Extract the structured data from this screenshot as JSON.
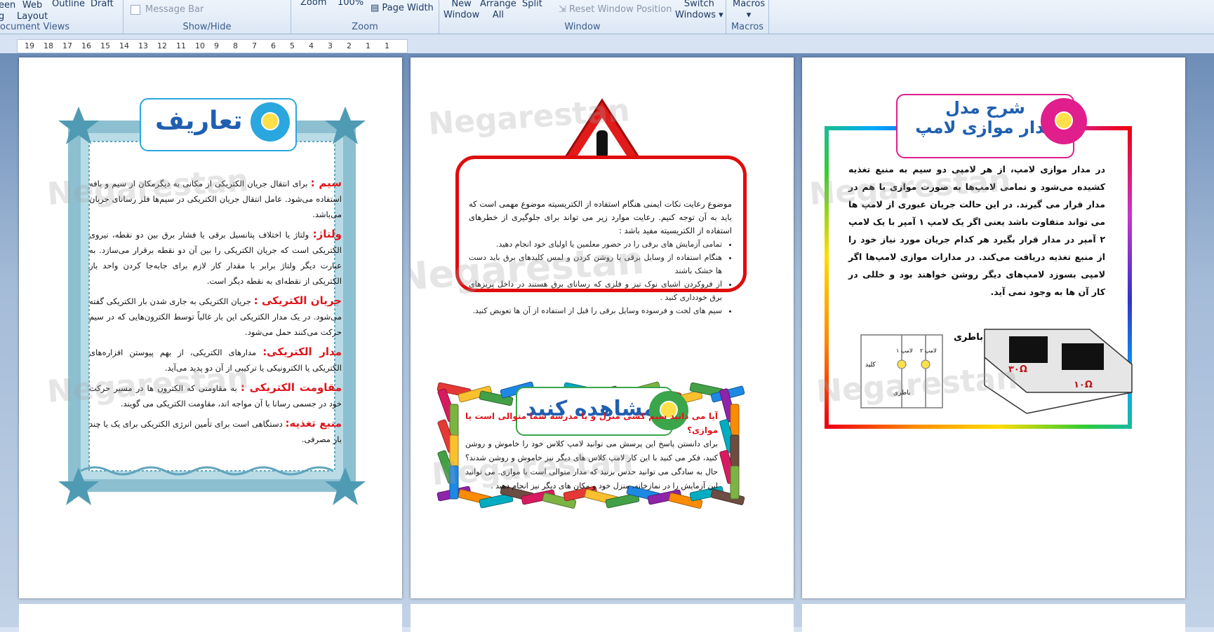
{
  "ribbon": {
    "document_views": {
      "full_screen": "een\ng",
      "web_layout": "Web\nLayout",
      "outline": "Outline",
      "draft": "Draft",
      "label": "ocument Views"
    },
    "show_hide": {
      "message_bar": "Message Bar",
      "label": "Show/Hide"
    },
    "zoom": {
      "zoom": "Zoom",
      "percent": "100%",
      "page_width": "Page Width",
      "label": "Zoom"
    },
    "window": {
      "new_window": "New\nWindow",
      "arrange_all": "Arrange\nAll",
      "split": "Split",
      "reset_position": "Reset Window Position",
      "switch_windows": "Switch\nWindows ▾",
      "label": "Window"
    },
    "macros": {
      "macros": "Macros\n▾",
      "label": "Macros"
    }
  },
  "ruler": {
    "ticks": [
      "19",
      "18",
      "17",
      "16",
      "15",
      "14",
      "13",
      "12",
      "11",
      "10",
      "9",
      "8",
      "7",
      "6",
      "5",
      "4",
      "3",
      "2",
      "1",
      "1"
    ]
  },
  "watermark": "Negarestan",
  "page1": {
    "title": "تعاریف",
    "definitions": [
      {
        "term": "سیم :",
        "text": " برای انتقال جریان الکتریکی از مکانی به دیگرمکان از سیم و بافه استفاده می‌شود. عامل انتقال جریان الکتریکی در سیم‌ها فلز رسانای جریان می‌باشد."
      },
      {
        "term": "ولتاژ:",
        "text": " ولتاژ یا اختلاف پتانسیل برقی یا فشار برق بین دو نقطه، نیروی الکتریکی است که جریان الکتریکی را بین آن دو نقطه برقرار می‌سازد. به عبارت دیگر ولتاژ برابر با مقدار کار لازم برای جابه‌جا کردن واحد بار الکتریکی از نقطه‌ای به نقطه دیگر است."
      },
      {
        "term": "جریان الکتریکی :",
        "text": " جریان الکتریکی به جاری شدن بار الکتریکی گفته می‌شود. در یک مدار الکتریکی این بار غالباً توسط الکترون‌هایی که در سیم حرکت می‌کنند حمل می‌شود."
      },
      {
        "term": "مدار الکتریکی:",
        "text": " مدارهای الکتریکی، از بهم پیوستن افزاره‌های الکتریکی یا الکترونیکی یا ترکیبی از آن دو پدید می‌آید."
      },
      {
        "term": "مقاومت الکتریکی :",
        "text": " به مقاومتی که الکترون ها در مسیر حرکت خود در جسمی رسانا با آن مواجه اند، مقاومت الکتریکی می گویند."
      },
      {
        "term": "منبع تغذیه:",
        "text": " دستگاهی است برای تأمین انرژی الکتریکی برای یک یا چند بار مصرفی."
      }
    ]
  },
  "page2": {
    "warning": {
      "intro": "موضوع رعایت نکات ایمنی هنگام استفاده از الکتریسیته موضوع مهمی است که باید به آن توجه کنیم. رعایت موارد زیر می تواند برای جلوگیری از خطرهای استفاده از الکتریسیته مفید باشد :",
      "items": [
        "تمامی آزمایش های برقی را در حضور معلمین یا اولیای خود انجام دهید.",
        "هنگام استفاده از وسایل برقی یا روشن کردن و لمس کلیدهای برق باید دست ها خشک باشند",
        "از فروکردن اشیای نوک تیز و فلزی که رسانای برق هستند در داخل پریزهای برق خودداری کنید .",
        "سیم های لخت و فرسوده وسایل برقی را قبل از استفاده از آن ها تعویض کنید."
      ]
    },
    "observe_title": "مشاهده کنید",
    "question": "آیا می دانید سیم کشی منزل و یا مدرسه شما متوالی است یا موازی؟",
    "answer": "برای دانستن پاسخ این پرسش می توانید لامپ کلاس خود را خاموش و روشن کنید، فکر می کنید با این کار لامپ کلاس های دیگر نیز خاموش و روشن شدند؟ حال به سادگی می توانید حدس بزنید که مدار متوالی است یا موازی. می توانید این آزمایش را در نمازخانه، منزل خود و مکان های دیگر نیز انجام دهید ."
  },
  "page3": {
    "title_line1": "شرح مدل",
    "title_line2": "مدار موازی لامپ",
    "text": "در مدار موازی لامپ، از هر لامپی دو سیم به منبع تغذیه کشیده می‌شود و تمامی لامپ‌ها به صورت موازی با هم در مدار قرار می گیرند. در این حالت جریان عبوری از لامپ ها می تواند متفاوت باشد یعنی اگر یک لامپ ۱ آمپر با یک لامپ ۲ آمپر در مدار قرار بگیرد هر کدام جریان مورد نیاز خود را از منبع تغذیه دریافت می‌کند. در مدارات موازی لامپ‌ها اگر لامپی بسوزد لامپ‌های دیگر روشن خواهند بود و خللی در کار آن ها به وجود نمی آید.",
    "diagram": {
      "battery": "باطری",
      "r1": "۳۰Ω",
      "r2": "۱۰Ω",
      "lamp1": "لامپ ۱",
      "lamp2": "لامپ ۲",
      "switch": "کلید",
      "battery_small": "باطری"
    }
  }
}
